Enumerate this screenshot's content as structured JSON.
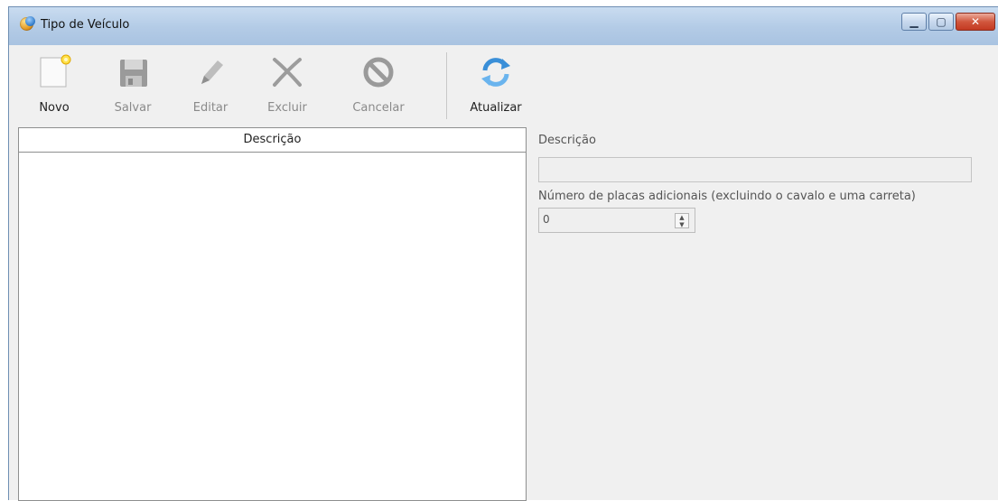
{
  "window": {
    "title": "Tipo de Veículo",
    "icon": "app-globe-icon",
    "controls": [
      "minimize-icon",
      "maximize-icon",
      "close-icon"
    ]
  },
  "toolbar": {
    "buttons": [
      {
        "label": "Novo",
        "icon": "new-document-icon",
        "enabled": true
      },
      {
        "label": "Salvar",
        "icon": "save-icon",
        "enabled": false
      },
      {
        "label": "Editar",
        "icon": "pencil-icon",
        "enabled": false
      },
      {
        "label": "Excluir",
        "icon": "delete-x-icon",
        "enabled": false
      },
      {
        "label": "Cancelar",
        "icon": "cancel-icon",
        "enabled": false
      },
      {
        "label": "Atualizar",
        "icon": "refresh-icon",
        "enabled": true
      }
    ]
  },
  "grid": {
    "columns": [
      "Descrição"
    ],
    "rows": []
  },
  "form": {
    "descricao_label": "Descrição",
    "descricao_value": "",
    "placas_label": "Número de placas adicionais (excluindo o cavalo e uma carreta)",
    "placas_value": "0"
  },
  "colors": {
    "titlebar": "#b3cbe6",
    "close_button": "#c43a22",
    "window_bg": "#f0f0f0",
    "refresh_accent": "#3a8fd8"
  }
}
